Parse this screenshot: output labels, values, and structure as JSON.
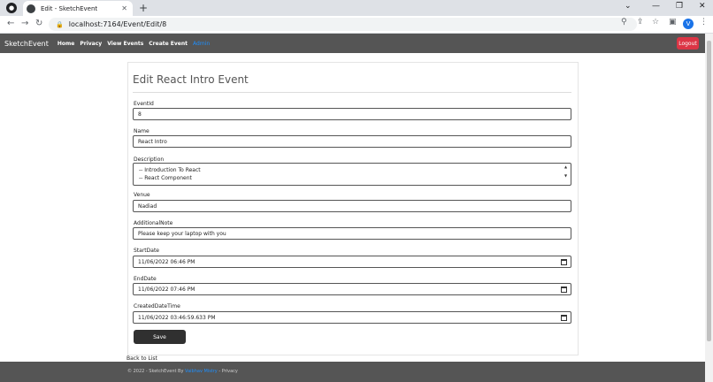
{
  "browser": {
    "tab_title": "Edit - SketchEvent",
    "url": "localhost:7164/Event/Edit/8",
    "profile_initial": "V"
  },
  "navbar": {
    "brand": "SketchEvent",
    "links": [
      "Home",
      "Privacy",
      "View Events",
      "Create Event"
    ],
    "active_link": "Admin",
    "logout": "Logout"
  },
  "form": {
    "title": "Edit React Intro Event",
    "fields": {
      "eventid": {
        "label": "EventId",
        "value": "8"
      },
      "name": {
        "label": "Name",
        "value": "React Intro"
      },
      "description": {
        "label": "Description",
        "lines": [
          "-- Introduction To React",
          "-- React Component"
        ]
      },
      "venue": {
        "label": "Venue",
        "value": "Nadiad"
      },
      "additionalnote": {
        "label": "AdditionalNote",
        "value": "Please keep your laptop with you"
      },
      "startdate": {
        "label": "StartDate",
        "value": "11/06/2022 06:46 PM"
      },
      "enddate": {
        "label": "EndDate",
        "value": "11/06/2022 07:46 PM"
      },
      "createddatetime": {
        "label": "CreatedDateTime",
        "value": "11/06/2022 03:46:59.633 PM"
      }
    },
    "save": "Save"
  },
  "back_link": "Back to List",
  "footer": {
    "prefix": "© 2022 - SketchEvent By",
    "author": "Vaibhav Mistry",
    "separator": "-",
    "privacy": "Privacy"
  }
}
